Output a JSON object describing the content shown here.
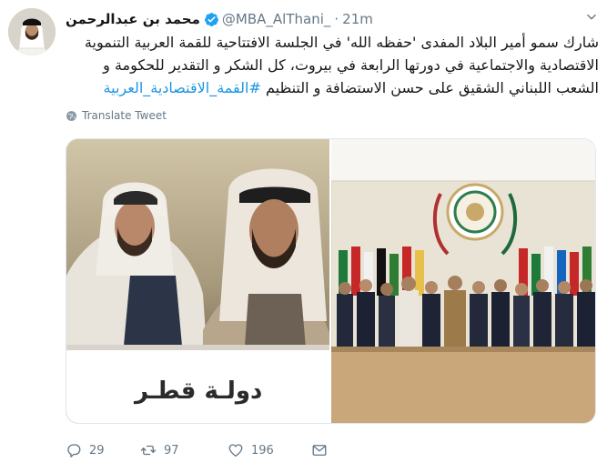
{
  "tweet": {
    "display_name": "محمد بن عبدالرحمن",
    "handle": "@MBA_AlThani_",
    "separator": "·",
    "time": "21m",
    "text_main": "شارك سمو أمير البلاد المفدى 'حفظه الله' في الجلسة الافتتاحية للقمة العربية التنموية الاقتصادية والاجتماعية في دورتها الرابعة في بيروت، كل الشكر و التقدير للحكومة و الشعب اللبناني الشقيق على حسن الاستضافة و التنظيم ",
    "hashtag": "#القمة_الاقتصادية_العربية",
    "translate_label": "Translate Tweet",
    "image_left_caption": "دولـة قطـر",
    "replies": "29",
    "retweets": "97",
    "likes": "196"
  },
  "icons": {
    "verified": "verified-badge-icon",
    "chevron": "chevron-down-icon",
    "translate": "globe-icon",
    "reply": "reply-icon",
    "retweet": "retweet-icon",
    "like": "heart-icon",
    "dm": "envelope-icon"
  },
  "colors": {
    "accent": "#1da1f2",
    "hashtag": "#1b95e0",
    "secondary_text": "#657786"
  }
}
